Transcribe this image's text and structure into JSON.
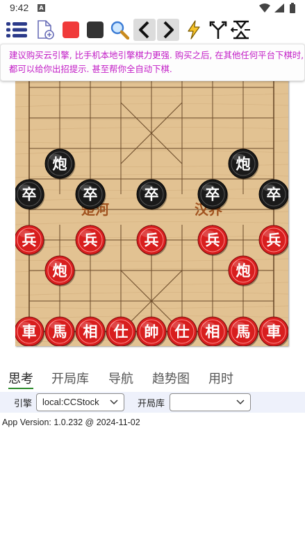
{
  "status_bar": {
    "time": "9:42",
    "badge": "A"
  },
  "toolbar": {
    "buttons": [
      {
        "icon": "menu-list-icon"
      },
      {
        "icon": "new-file-icon"
      },
      {
        "icon": "red-square-icon",
        "color": "#f03a3a"
      },
      {
        "icon": "black-square-icon",
        "color": "#333333"
      },
      {
        "icon": "search-icon"
      },
      {
        "icon": "chevron-left-icon"
      },
      {
        "icon": "chevron-right-icon"
      },
      {
        "icon": "lightning-icon"
      },
      {
        "icon": "branch-icon"
      },
      {
        "icon": "flip-board-icon"
      }
    ]
  },
  "banner": {
    "text": "建议购买云引擎, 比手机本地引擎棋力更强. 购买之后, 在其他任何平台下棋时, 都可以给你出招提示. 甚至帮你全自动下棋."
  },
  "board": {
    "river_left": "楚河",
    "river_right": "汉界",
    "colors": {
      "wood": "#e2c292",
      "line": "#6b4a2a",
      "red_piece": "#d81e1e",
      "black_piece": "#1a1a1a",
      "river_text": "#a0521e"
    },
    "black_pieces": [
      {
        "char": "炮",
        "file": 1,
        "rank": 5.5
      },
      {
        "char": "炮",
        "file": 7,
        "rank": 5.5
      },
      {
        "char": "卒",
        "file": 0,
        "rank": 4.5
      },
      {
        "char": "卒",
        "file": 2,
        "rank": 4.5
      },
      {
        "char": "卒",
        "file": 4,
        "rank": 4.5
      },
      {
        "char": "卒",
        "file": 6,
        "rank": 4.5
      },
      {
        "char": "卒",
        "file": 8,
        "rank": 4.5
      }
    ],
    "red_pieces": [
      {
        "char": "兵",
        "file": 0,
        "rank": 3
      },
      {
        "char": "兵",
        "file": 2,
        "rank": 3
      },
      {
        "char": "兵",
        "file": 4,
        "rank": 3
      },
      {
        "char": "兵",
        "file": 6,
        "rank": 3
      },
      {
        "char": "兵",
        "file": 8,
        "rank": 3
      },
      {
        "char": "炮",
        "file": 1,
        "rank": 2
      },
      {
        "char": "炮",
        "file": 7,
        "rank": 2
      },
      {
        "char": "車",
        "file": 0,
        "rank": 0
      },
      {
        "char": "馬",
        "file": 1,
        "rank": 0
      },
      {
        "char": "相",
        "file": 2,
        "rank": 0
      },
      {
        "char": "仕",
        "file": 3,
        "rank": 0
      },
      {
        "char": "帥",
        "file": 4,
        "rank": 0
      },
      {
        "char": "仕",
        "file": 5,
        "rank": 0
      },
      {
        "char": "相",
        "file": 6,
        "rank": 0
      },
      {
        "char": "馬",
        "file": 7,
        "rank": 0
      },
      {
        "char": "車",
        "file": 8,
        "rank": 0
      }
    ]
  },
  "tabs": [
    {
      "label": "思考",
      "active": true
    },
    {
      "label": "开局库",
      "active": false
    },
    {
      "label": "导航",
      "active": false
    },
    {
      "label": "趋势图",
      "active": false
    },
    {
      "label": "用时",
      "active": false
    }
  ],
  "engine_row": {
    "engine_label": "引擎",
    "engine_value": "local:CCStock",
    "opening_label": "开局库",
    "opening_value": ""
  },
  "version": "App Version: 1.0.232 @ 2024-11-02"
}
